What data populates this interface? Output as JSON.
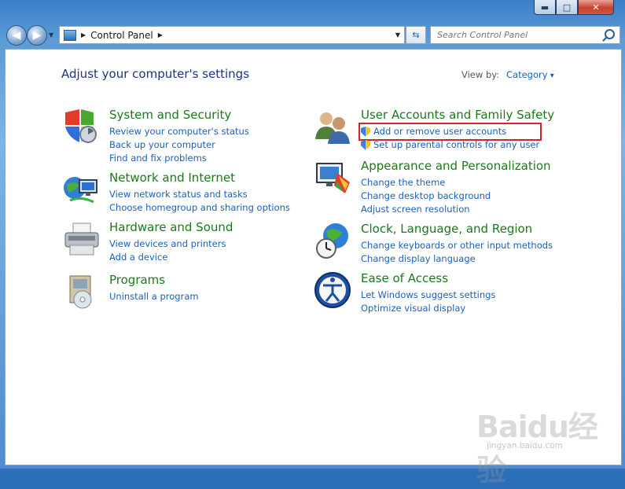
{
  "window": {
    "controls": {
      "minimize": "▬",
      "maximize": "□",
      "close": "✕"
    }
  },
  "toolbar": {
    "back_icon": "back-arrow-icon",
    "forward_icon": "forward-arrow-icon",
    "address": {
      "crumb": "Control Panel"
    },
    "search_placeholder": "Search Control Panel"
  },
  "header": {
    "title": "Adjust your computer's settings",
    "view_by_label": "View by:",
    "view_by_value": "Category"
  },
  "categories": [
    {
      "title": "System and Security",
      "icon": "system-security-shield-icon",
      "links": [
        "Review your computer's status",
        "Back up your computer",
        "Find and fix problems"
      ]
    },
    {
      "title": "Network and Internet",
      "icon": "network-globe-icon",
      "links": [
        "View network status and tasks",
        "Choose homegroup and sharing options"
      ]
    },
    {
      "title": "Hardware and Sound",
      "icon": "printer-icon",
      "links": [
        "View devices and printers",
        "Add a device"
      ]
    },
    {
      "title": "Programs",
      "icon": "programs-icon",
      "links": [
        "Uninstall a program"
      ]
    },
    {
      "title": "User Accounts and Family Safety",
      "icon": "user-accounts-icon",
      "links": [
        "Add or remove user accounts",
        "Set up parental controls for any user"
      ]
    },
    {
      "title": "Appearance and Personalization",
      "icon": "appearance-monitor-icon",
      "links": [
        "Change the theme",
        "Change desktop background",
        "Adjust screen resolution"
      ]
    },
    {
      "title": "Clock, Language, and Region",
      "icon": "clock-globe-icon",
      "links": [
        "Change keyboards or other input methods",
        "Change display language"
      ]
    },
    {
      "title": "Ease of Access",
      "icon": "ease-of-access-icon",
      "links": [
        "Let Windows suggest settings",
        "Optimize visual display"
      ]
    }
  ],
  "watermark": {
    "logo": "Baidu经验",
    "url": "jingyan.baidu.com"
  },
  "colors": {
    "category_title": "#1a7a1a",
    "link": "#1e5fb8",
    "heading": "#1e3287",
    "highlight": "#d42424"
  }
}
